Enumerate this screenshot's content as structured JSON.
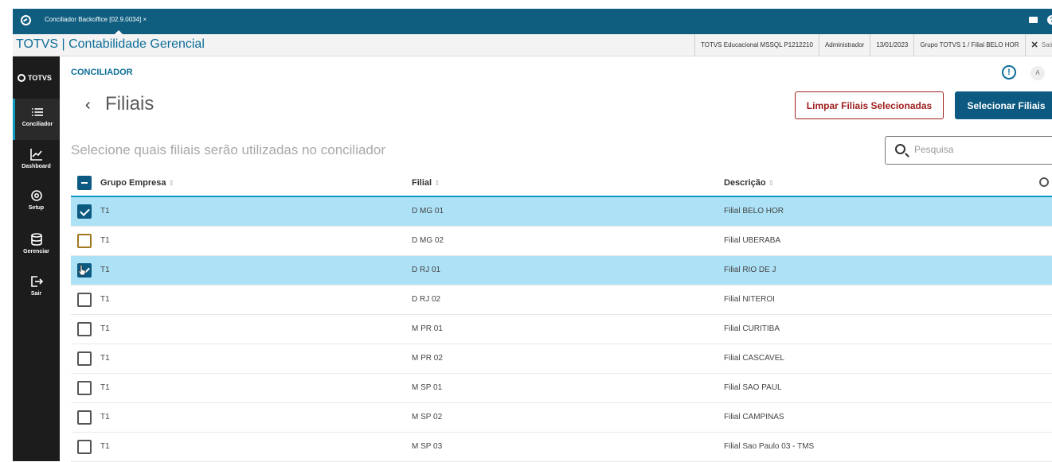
{
  "window": {
    "tab_label": "Conciliador Backoffice [02.9.0034] ×",
    "mail_icon": "mail-icon",
    "help_icon": "help-icon"
  },
  "header": {
    "app_title": "TOTVS | Contabilidade Gerencial",
    "environment": "TOTVS Educacional MSSQL P1212210",
    "user": "Administrador",
    "date": "13/01/2023",
    "group": "Grupo TOTVS 1 / Filial BELO HOR",
    "exit_label": "Sair"
  },
  "sidebar": {
    "logo": "TOTVS",
    "items": [
      {
        "label": "Conciliador",
        "icon": "list-icon",
        "active": true
      },
      {
        "label": "Dashboard",
        "icon": "chart-icon",
        "active": false
      },
      {
        "label": "Setup",
        "icon": "gear-icon",
        "active": false
      },
      {
        "label": "Gerenciar",
        "icon": "database-icon",
        "active": false
      },
      {
        "label": "Sair",
        "icon": "logout-icon",
        "active": false
      }
    ]
  },
  "page": {
    "breadcrumb": "CONCILIADOR",
    "title": "Filiais",
    "subtitle": "Selecione quais filiais serão utilizadas no conciliador",
    "clear_button": "Limpar Filiais Selecionadas",
    "select_button": "Selecionar Filiais",
    "search_placeholder": "Pesquisa",
    "avatar_initial": "A",
    "alert_symbol": "!"
  },
  "table": {
    "columns": [
      "Grupo Empresa",
      "Filial",
      "Descrição"
    ],
    "sort_glyph": "⇕",
    "rows": [
      {
        "grupo": "T1",
        "filial": "D MG 01",
        "descricao": "Filial BELO HOR",
        "selected": true
      },
      {
        "grupo": "T1",
        "filial": "D MG 02",
        "descricao": "Filial UBERABA",
        "selected": false
      },
      {
        "grupo": "T1",
        "filial": "D RJ 01",
        "descricao": "Filial RIO DE J",
        "selected": true
      },
      {
        "grupo": "T1",
        "filial": "D RJ 02",
        "descricao": "Filial NITEROI",
        "selected": false
      },
      {
        "grupo": "T1",
        "filial": "M PR 01",
        "descricao": "Filial CURITIBA",
        "selected": false
      },
      {
        "grupo": "T1",
        "filial": "M PR 02",
        "descricao": "Filial CASCAVEL",
        "selected": false
      },
      {
        "grupo": "T1",
        "filial": "M SP 01",
        "descricao": "Filial SAO PAUL",
        "selected": false
      },
      {
        "grupo": "T1",
        "filial": "M SP 02",
        "descricao": "Filial CAMPINAS",
        "selected": false
      },
      {
        "grupo": "T1",
        "filial": "M SP 03",
        "descricao": "Filial Sao Paulo 03 - TMS",
        "selected": false
      }
    ]
  },
  "colors": {
    "title_bar": "#0f5e80",
    "accent": "#0c5a82",
    "selected_row": "#ade1f5",
    "danger": "#a02020"
  }
}
